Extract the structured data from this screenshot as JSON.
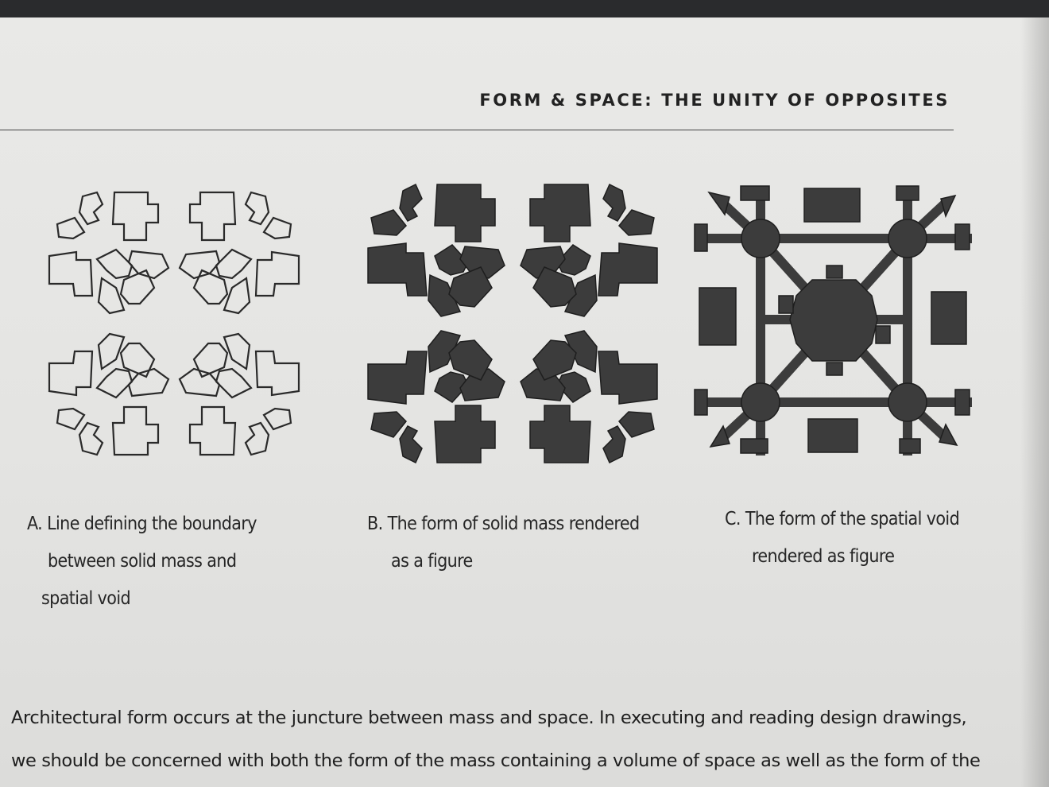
{
  "running_head": "FORM & SPACE: THE UNITY OF OPPOSITES",
  "figures": [
    {
      "letter": "A.",
      "caption_lines": [
        "Line defining the boundary",
        "between solid mass and",
        "spatial void"
      ]
    },
    {
      "letter": "B.",
      "caption_lines": [
        "The form of solid mass rendered",
        "as a figure"
      ]
    },
    {
      "letter": "C.",
      "caption_lines": [
        "The form of the spatial void",
        "rendered as figure"
      ]
    }
  ],
  "body": {
    "line1": "Architectural form occurs at the juncture between mass and space. In executing and reading design drawings,",
    "line2": "we should be concerned with both the form of the mass containing a volume of space as well as the form of the"
  },
  "colors": {
    "paper": "#e6e6e4",
    "ink": "#222222",
    "mass_fill": "#3c3c3c"
  }
}
